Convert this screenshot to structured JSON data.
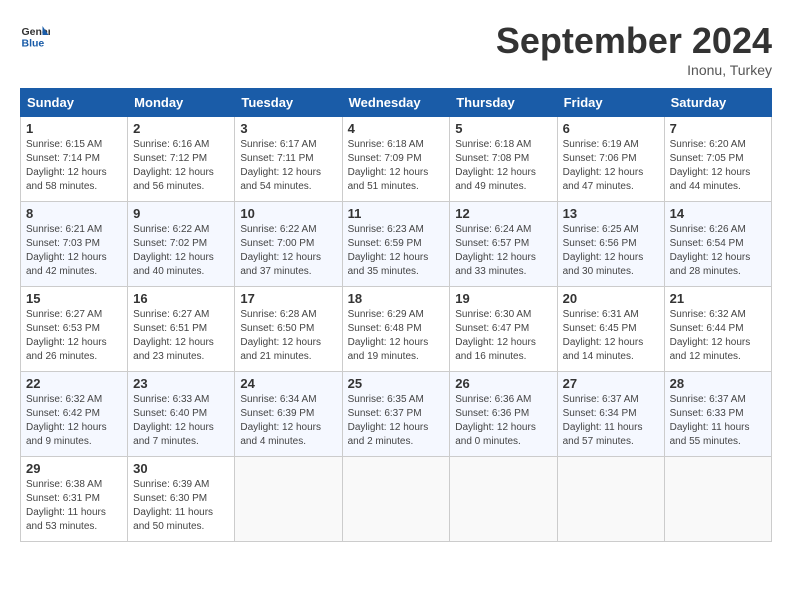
{
  "logo": {
    "line1": "General",
    "line2": "Blue"
  },
  "title": "September 2024",
  "subtitle": "Inonu, Turkey",
  "days_of_week": [
    "Sunday",
    "Monday",
    "Tuesday",
    "Wednesday",
    "Thursday",
    "Friday",
    "Saturday"
  ],
  "weeks": [
    [
      {
        "day": "1",
        "info": "Sunrise: 6:15 AM\nSunset: 7:14 PM\nDaylight: 12 hours\nand 58 minutes."
      },
      {
        "day": "2",
        "info": "Sunrise: 6:16 AM\nSunset: 7:12 PM\nDaylight: 12 hours\nand 56 minutes."
      },
      {
        "day": "3",
        "info": "Sunrise: 6:17 AM\nSunset: 7:11 PM\nDaylight: 12 hours\nand 54 minutes."
      },
      {
        "day": "4",
        "info": "Sunrise: 6:18 AM\nSunset: 7:09 PM\nDaylight: 12 hours\nand 51 minutes."
      },
      {
        "day": "5",
        "info": "Sunrise: 6:18 AM\nSunset: 7:08 PM\nDaylight: 12 hours\nand 49 minutes."
      },
      {
        "day": "6",
        "info": "Sunrise: 6:19 AM\nSunset: 7:06 PM\nDaylight: 12 hours\nand 47 minutes."
      },
      {
        "day": "7",
        "info": "Sunrise: 6:20 AM\nSunset: 7:05 PM\nDaylight: 12 hours\nand 44 minutes."
      }
    ],
    [
      {
        "day": "8",
        "info": "Sunrise: 6:21 AM\nSunset: 7:03 PM\nDaylight: 12 hours\nand 42 minutes."
      },
      {
        "day": "9",
        "info": "Sunrise: 6:22 AM\nSunset: 7:02 PM\nDaylight: 12 hours\nand 40 minutes."
      },
      {
        "day": "10",
        "info": "Sunrise: 6:22 AM\nSunset: 7:00 PM\nDaylight: 12 hours\nand 37 minutes."
      },
      {
        "day": "11",
        "info": "Sunrise: 6:23 AM\nSunset: 6:59 PM\nDaylight: 12 hours\nand 35 minutes."
      },
      {
        "day": "12",
        "info": "Sunrise: 6:24 AM\nSunset: 6:57 PM\nDaylight: 12 hours\nand 33 minutes."
      },
      {
        "day": "13",
        "info": "Sunrise: 6:25 AM\nSunset: 6:56 PM\nDaylight: 12 hours\nand 30 minutes."
      },
      {
        "day": "14",
        "info": "Sunrise: 6:26 AM\nSunset: 6:54 PM\nDaylight: 12 hours\nand 28 minutes."
      }
    ],
    [
      {
        "day": "15",
        "info": "Sunrise: 6:27 AM\nSunset: 6:53 PM\nDaylight: 12 hours\nand 26 minutes."
      },
      {
        "day": "16",
        "info": "Sunrise: 6:27 AM\nSunset: 6:51 PM\nDaylight: 12 hours\nand 23 minutes."
      },
      {
        "day": "17",
        "info": "Sunrise: 6:28 AM\nSunset: 6:50 PM\nDaylight: 12 hours\nand 21 minutes."
      },
      {
        "day": "18",
        "info": "Sunrise: 6:29 AM\nSunset: 6:48 PM\nDaylight: 12 hours\nand 19 minutes."
      },
      {
        "day": "19",
        "info": "Sunrise: 6:30 AM\nSunset: 6:47 PM\nDaylight: 12 hours\nand 16 minutes."
      },
      {
        "day": "20",
        "info": "Sunrise: 6:31 AM\nSunset: 6:45 PM\nDaylight: 12 hours\nand 14 minutes."
      },
      {
        "day": "21",
        "info": "Sunrise: 6:32 AM\nSunset: 6:44 PM\nDaylight: 12 hours\nand 12 minutes."
      }
    ],
    [
      {
        "day": "22",
        "info": "Sunrise: 6:32 AM\nSunset: 6:42 PM\nDaylight: 12 hours\nand 9 minutes."
      },
      {
        "day": "23",
        "info": "Sunrise: 6:33 AM\nSunset: 6:40 PM\nDaylight: 12 hours\nand 7 minutes."
      },
      {
        "day": "24",
        "info": "Sunrise: 6:34 AM\nSunset: 6:39 PM\nDaylight: 12 hours\nand 4 minutes."
      },
      {
        "day": "25",
        "info": "Sunrise: 6:35 AM\nSunset: 6:37 PM\nDaylight: 12 hours\nand 2 minutes."
      },
      {
        "day": "26",
        "info": "Sunrise: 6:36 AM\nSunset: 6:36 PM\nDaylight: 12 hours\nand 0 minutes."
      },
      {
        "day": "27",
        "info": "Sunrise: 6:37 AM\nSunset: 6:34 PM\nDaylight: 11 hours\nand 57 minutes."
      },
      {
        "day": "28",
        "info": "Sunrise: 6:37 AM\nSunset: 6:33 PM\nDaylight: 11 hours\nand 55 minutes."
      }
    ],
    [
      {
        "day": "29",
        "info": "Sunrise: 6:38 AM\nSunset: 6:31 PM\nDaylight: 11 hours\nand 53 minutes."
      },
      {
        "day": "30",
        "info": "Sunrise: 6:39 AM\nSunset: 6:30 PM\nDaylight: 11 hours\nand 50 minutes."
      },
      null,
      null,
      null,
      null,
      null
    ]
  ]
}
